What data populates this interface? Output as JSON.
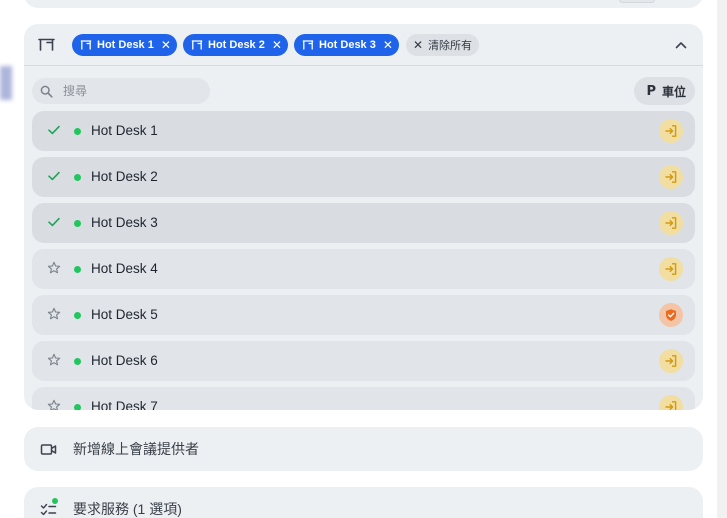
{
  "resource_picker": {
    "selected_chips": [
      {
        "label": "Hot Desk 1"
      },
      {
        "label": "Hot Desk 2"
      },
      {
        "label": "Hot Desk 3"
      }
    ],
    "clear_all_label": "清除所有",
    "search": {
      "placeholder": "搜尋",
      "value": ""
    },
    "parking_button_label": "車位",
    "desks": [
      {
        "name": "Hot Desk 1",
        "selected": true,
        "status_color": "#22c55e",
        "action": "check-in"
      },
      {
        "name": "Hot Desk 2",
        "selected": true,
        "status_color": "#22c55e",
        "action": "check-in"
      },
      {
        "name": "Hot Desk 3",
        "selected": true,
        "status_color": "#22c55e",
        "action": "check-in"
      },
      {
        "name": "Hot Desk 4",
        "selected": false,
        "status_color": "#22c55e",
        "action": "check-in"
      },
      {
        "name": "Hot Desk 5",
        "selected": false,
        "status_color": "#22c55e",
        "action": "shield"
      },
      {
        "name": "Hot Desk 6",
        "selected": false,
        "status_color": "#22c55e",
        "action": "check-in"
      },
      {
        "name": "Hot Desk 7",
        "selected": false,
        "status_color": "#22c55e",
        "action": "check-in"
      }
    ]
  },
  "add_conference_provider": {
    "label": "新增線上會議提供者",
    "icon": "video-camera-icon"
  },
  "request_services": {
    "label": "要求服務 (1 選項)",
    "icon": "checklist-icon"
  },
  "colors": {
    "chip_blue": "#1e63e9",
    "available_green": "#22c55e",
    "checkin_yellow": "#f1dea0",
    "shield_orange": "#f4c4a6",
    "card_bg": "#edf0f3"
  }
}
